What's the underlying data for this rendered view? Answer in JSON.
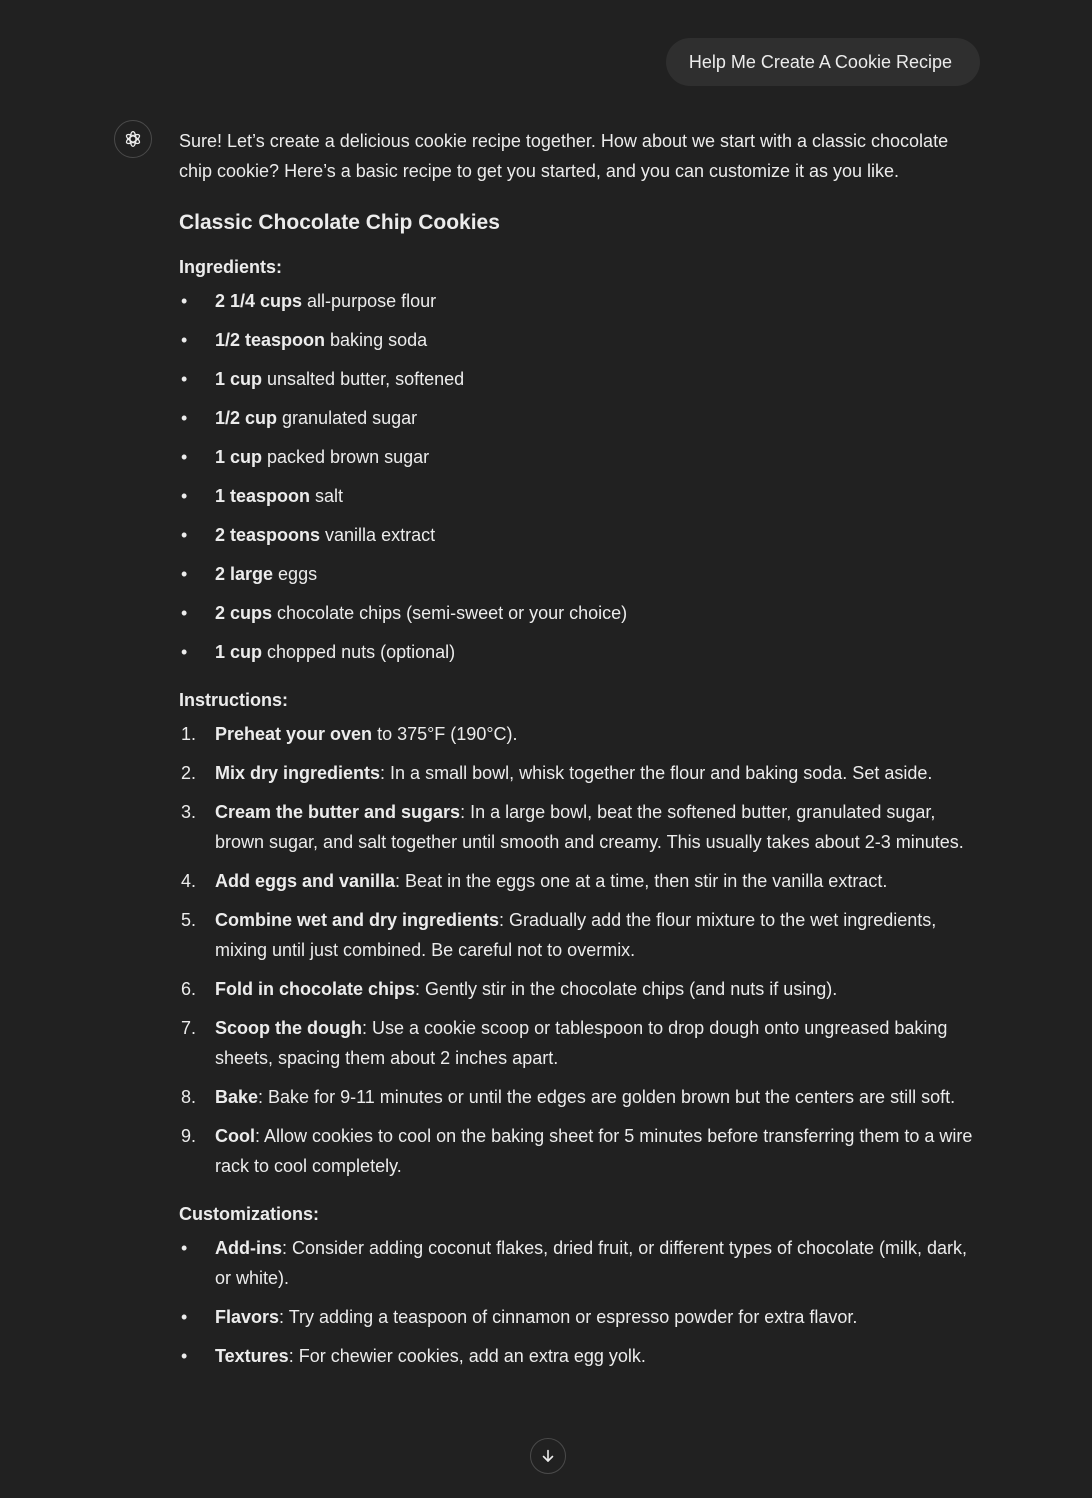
{
  "user_message": "Help Me Create A Cookie Recipe",
  "assistant": {
    "intro": "Sure! Let’s create a delicious cookie recipe together. How about we start with a classic chocolate chip cookie? Here’s a basic recipe to get you started, and you can customize it as you like.",
    "recipe_title": "Classic Chocolate Chip Cookies",
    "ingredients_heading": "Ingredients:",
    "ingredients": [
      {
        "bold": "2 1/4 cups",
        "text": " all-purpose flour"
      },
      {
        "bold": "1/2 teaspoon",
        "text": " baking soda"
      },
      {
        "bold": "1 cup",
        "text": " unsalted butter, softened"
      },
      {
        "bold": "1/2 cup",
        "text": " granulated sugar"
      },
      {
        "bold": "1 cup",
        "text": " packed brown sugar"
      },
      {
        "bold": "1 teaspoon",
        "text": " salt"
      },
      {
        "bold": "2 teaspoons",
        "text": " vanilla extract"
      },
      {
        "bold": "2 large",
        "text": " eggs"
      },
      {
        "bold": "2 cups",
        "text": " chocolate chips (semi-sweet or your choice)"
      },
      {
        "bold": "1 cup",
        "text": " chopped nuts (optional)"
      }
    ],
    "instructions_heading": "Instructions:",
    "instructions": [
      {
        "num": "1.",
        "bold": "Preheat your oven",
        "text": " to 375°F (190°C)."
      },
      {
        "num": "2.",
        "bold": "Mix dry ingredients",
        "text": ": In a small bowl, whisk together the flour and baking soda. Set aside."
      },
      {
        "num": "3.",
        "bold": "Cream the butter and sugars",
        "text": ": In a large bowl, beat the softened butter, granulated sugar, brown sugar, and salt together until smooth and creamy. This usually takes about 2-3 minutes."
      },
      {
        "num": "4.",
        "bold": "Add eggs and vanilla",
        "text": ": Beat in the eggs one at a time, then stir in the vanilla extract."
      },
      {
        "num": "5.",
        "bold": "Combine wet and dry ingredients",
        "text": ": Gradually add the flour mixture to the wet ingredients, mixing until just combined. Be careful not to overmix."
      },
      {
        "num": "6.",
        "bold": "Fold in chocolate chips",
        "text": ": Gently stir in the chocolate chips (and nuts if using)."
      },
      {
        "num": "7.",
        "bold": "Scoop the dough",
        "text": ": Use a cookie scoop or tablespoon to drop dough onto ungreased baking sheets, spacing them about 2 inches apart."
      },
      {
        "num": "8.",
        "bold": "Bake",
        "text": ": Bake for 9-11 minutes or until the edges are golden brown but the centers are still soft."
      },
      {
        "num": "9.",
        "bold": "Cool",
        "text": ": Allow cookies to cool on the baking sheet for 5 minutes before transferring them to a wire rack to cool completely."
      }
    ],
    "customizations_heading": "Customizations:",
    "customizations": [
      {
        "bold": "Add-ins",
        "text": ": Consider adding coconut flakes, dried fruit, or different types of chocolate (milk, dark, or white)."
      },
      {
        "bold": "Flavors",
        "text": ": Try adding a teaspoon of cinnamon or espresso powder for extra flavor."
      },
      {
        "bold": "Textures",
        "text": ": For chewier cookies, add an extra egg yolk."
      }
    ]
  },
  "icons": {
    "avatar": "openai-logo-icon",
    "scroll": "arrow-down-icon"
  },
  "colors": {
    "background": "#212121",
    "bubble": "#2f2f2f",
    "text": "#ececec"
  }
}
